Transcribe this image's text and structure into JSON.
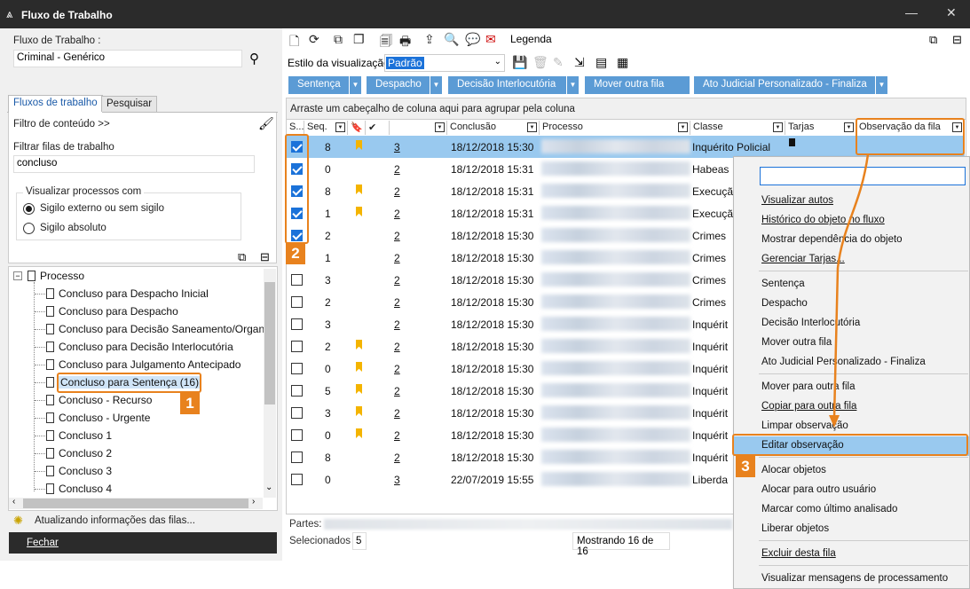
{
  "window": {
    "title": "Fluxo de Trabalho"
  },
  "left": {
    "workflow_label": "Fluxo de Trabalho :",
    "workflow_value": "Criminal - Genérico",
    "tabs": [
      "Fluxos de trabalho",
      "Pesquisar"
    ],
    "content_filter": "Filtro de conteúdo >>",
    "filter_queues_label": "Filtrar filas de trabalho",
    "filter_queues_value": "concluso",
    "view_group_label": "Visualizar processos com",
    "radio_options": [
      "Sigilo externo ou sem sigilo",
      "Sigilo absoluto"
    ],
    "tree_root": "Processo",
    "tree_items": [
      "Concluso para Despacho Inicial",
      "Concluso para Despacho",
      "Concluso para Decisão Saneamento/Organ",
      "Concluso para Decisão Interlocutória",
      "Concluso para Julgamento Antecipado",
      "Concluso para Sentença (16)",
      "Concluso - Recurso",
      "Concluso - Urgente",
      "Concluso 1",
      "Concluso 2",
      "Concluso 3",
      "Concluso 4"
    ],
    "status": "Atualizando informações das filas...",
    "close": "Fechar"
  },
  "toolbar": {
    "legend": "Legenda",
    "view_style_label": "Estilo da visualização",
    "view_style_value": "Padrão",
    "actions": [
      "Sentença",
      "Despacho",
      "Decisão Interlocutória",
      "Mover outra fila",
      "Ato Judicial Personalizado - Finaliza"
    ]
  },
  "grid": {
    "group_hint": "Arraste um cabeçalho de coluna aqui para agrupar pela coluna",
    "headers": {
      "s": "S...",
      "seq": "Seq.",
      "conclusao": "Conclusão",
      "processo": "Processo",
      "classe": "Classe",
      "tarjas": "Tarjas",
      "obs": "Observação da fila"
    },
    "rows": [
      {
        "checked": true,
        "seq": "8",
        "flag": true,
        "n": "3",
        "date": "18/12/2018 15:30",
        "classe": "Inquérito Policial"
      },
      {
        "checked": true,
        "seq": "0",
        "flag": false,
        "n": "2",
        "date": "18/12/2018 15:31",
        "classe": "Habeas"
      },
      {
        "checked": true,
        "seq": "8",
        "flag": true,
        "n": "2",
        "date": "18/12/2018 15:31",
        "classe": "Execuçã"
      },
      {
        "checked": true,
        "seq": "1",
        "flag": true,
        "n": "2",
        "date": "18/12/2018 15:31",
        "classe": "Execuçã"
      },
      {
        "checked": true,
        "seq": "2",
        "flag": false,
        "n": "2",
        "date": "18/12/2018 15:30",
        "classe": "Crimes"
      },
      {
        "checked": false,
        "seq": "1",
        "flag": false,
        "n": "2",
        "date": "18/12/2018 15:30",
        "classe": "Crimes"
      },
      {
        "checked": false,
        "seq": "3",
        "flag": false,
        "n": "2",
        "date": "18/12/2018 15:30",
        "classe": "Crimes"
      },
      {
        "checked": false,
        "seq": "2",
        "flag": false,
        "n": "2",
        "date": "18/12/2018 15:30",
        "classe": "Crimes"
      },
      {
        "checked": false,
        "seq": "3",
        "flag": false,
        "n": "2",
        "date": "18/12/2018 15:30",
        "classe": "Inquérit"
      },
      {
        "checked": false,
        "seq": "2",
        "flag": true,
        "n": "2",
        "date": "18/12/2018 15:30",
        "classe": "Inquérit"
      },
      {
        "checked": false,
        "seq": "0",
        "flag": true,
        "n": "2",
        "date": "18/12/2018 15:30",
        "classe": "Inquérit"
      },
      {
        "checked": false,
        "seq": "5",
        "flag": true,
        "n": "2",
        "date": "18/12/2018 15:30",
        "classe": "Inquérit"
      },
      {
        "checked": false,
        "seq": "3",
        "flag": true,
        "n": "2",
        "date": "18/12/2018 15:30",
        "classe": "Inquérit"
      },
      {
        "checked": false,
        "seq": "0",
        "flag": true,
        "n": "2",
        "date": "18/12/2018 15:30",
        "classe": "Inquérit"
      },
      {
        "checked": false,
        "seq": "8",
        "flag": false,
        "n": "2",
        "date": "18/12/2018 15:30",
        "classe": "Inquérit"
      },
      {
        "checked": false,
        "seq": "0",
        "flag": false,
        "n": "3",
        "date": "22/07/2019 15:55",
        "classe": "Liberda"
      }
    ],
    "parts_label": "Partes:",
    "selected_label": "Selecionados",
    "selected_value": "5",
    "showing": "Mostrando 16 de 16"
  },
  "context_menu": {
    "groups": [
      [
        "Visualizar autos",
        "Histórico do objeto no fluxo",
        "Mostrar dependência do objeto",
        "Gerenciar Tarjas..."
      ],
      [
        "Sentença",
        "Despacho",
        "Decisão Interlocutória",
        "Mover outra fila",
        "Ato Judicial Personalizado - Finaliza"
      ],
      [
        "Mover para outra fila",
        "Copiar para outra fila",
        "Limpar observação",
        "Editar observação"
      ],
      [
        "Alocar objetos",
        "Alocar para outro usuário",
        "Marcar como último analisado",
        "Liberar objetos"
      ],
      [
        "Excluir desta fila"
      ],
      [
        "Visualizar mensagens de processamento"
      ]
    ]
  },
  "badges": [
    "1",
    "2",
    "3"
  ],
  "colors": {
    "accent": "#e8821e",
    "selection": "#99c9ef",
    "button": "#5b9bd5"
  }
}
